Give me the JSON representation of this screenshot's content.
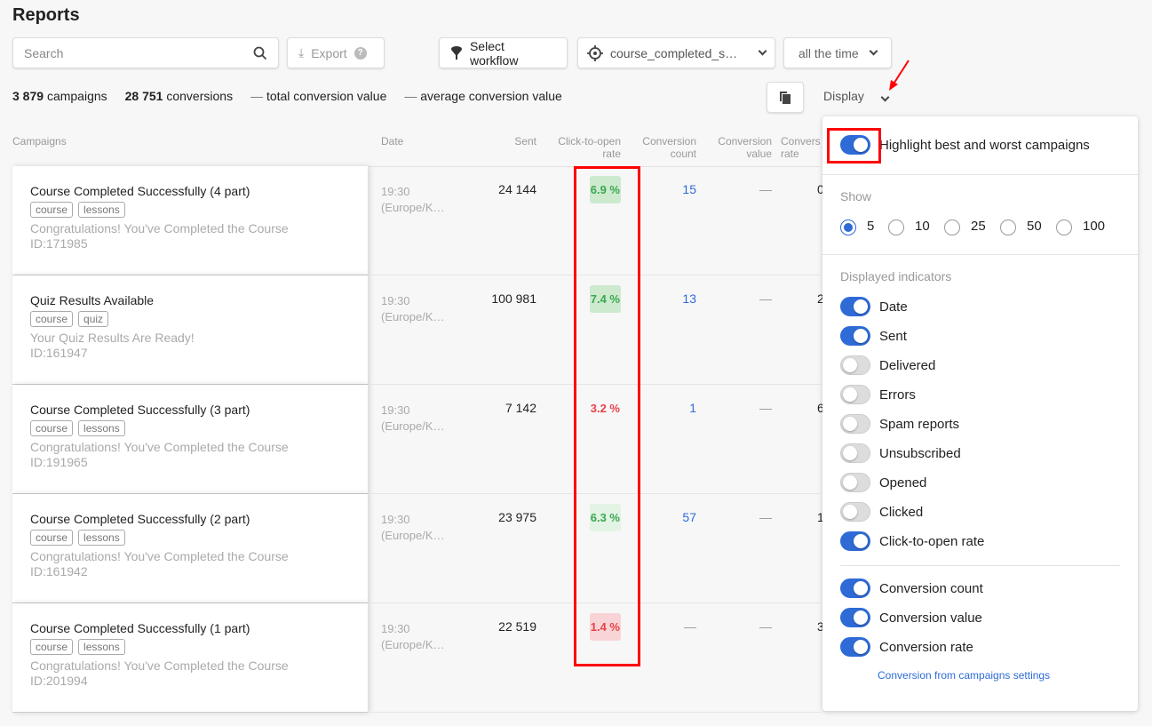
{
  "header": {
    "title": "Reports"
  },
  "toolbar": {
    "search_placeholder": "Search",
    "export_label": "Export",
    "workflow_label": "Select workflow",
    "segment_value": "course_completed_s…",
    "period_value": "all the time",
    "display_label": "Display"
  },
  "summary": {
    "campaigns_count": "3 879",
    "campaigns_label": "campaigns",
    "conversions_count": "28 751",
    "conversions_label": "conversions",
    "total_value": "—",
    "total_label": "total conversion value",
    "avg_value": "—",
    "avg_label": "average conversion value"
  },
  "columns": {
    "campaigns": "Campaigns",
    "date": "Date",
    "sent": "Sent",
    "ctor": "Click-to-open rate",
    "conv_count": "Conversion count",
    "conv_value": "Conversion value",
    "conv_rate": "Conversion rate"
  },
  "rows": [
    {
      "name": "Course Completed Successfully (4 part)",
      "tags": [
        "course",
        "lessons"
      ],
      "subject": "Congratulations! You've Completed the Course",
      "id": "ID:171985",
      "date": "19:30",
      "tz": "(Europe/K…",
      "sent": "24 144",
      "ctor": "6.9 %",
      "ctor_status": "best",
      "conv_count": "15",
      "conv_value": "—",
      "conv_rate": "0"
    },
    {
      "name": "Quiz Results Available",
      "tags": [
        "course",
        "quiz"
      ],
      "subject": "Your Quiz Results Are Ready!",
      "id": "ID:161947",
      "date": "19:30",
      "tz": "(Europe/K…",
      "sent": "100 981",
      "ctor": "7.4 %",
      "ctor_status": "best",
      "conv_count": "13",
      "conv_value": "—",
      "conv_rate": "2"
    },
    {
      "name": "Course Completed Successfully (3 part)",
      "tags": [
        "course",
        "lessons"
      ],
      "subject": "Congratulations! You've Completed the Course",
      "id": "ID:191965",
      "date": "19:30",
      "tz": "(Europe/K…",
      "sent": "7 142",
      "ctor": "3.2 %",
      "ctor_status": "worst",
      "conv_count": "1",
      "conv_value": "—",
      "conv_rate": "6"
    },
    {
      "name": "Course Completed Successfully (2 part)",
      "tags": [
        "course",
        "lessons"
      ],
      "subject": "Congratulations! You've Completed the Course",
      "id": "ID:161942",
      "date": "19:30",
      "tz": "(Europe/K…",
      "sent": "23 975",
      "ctor": "6.3 %",
      "ctor_status": "good",
      "conv_count": "57",
      "conv_value": "—",
      "conv_rate": "1"
    },
    {
      "name": "Course Completed Successfully (1 part)",
      "tags": [
        "course",
        "lessons"
      ],
      "subject": "Congratulations! You've Completed the Course",
      "id": "ID:201994",
      "date": "19:30",
      "tz": "(Europe/K…",
      "sent": "22 519",
      "ctor": "1.4 %",
      "ctor_status": "worst-strong",
      "conv_count": "—",
      "conv_value": "—",
      "conv_rate": "3"
    }
  ],
  "panel": {
    "highlight": {
      "label": "Highlight best and worst campaigns",
      "on": true
    },
    "show_label": "Show",
    "show_options": [
      "5",
      "10",
      "25",
      "50",
      "100"
    ],
    "show_selected": "5",
    "indicators_label": "Displayed indicators",
    "indicators": [
      {
        "label": "Date",
        "on": true
      },
      {
        "label": "Sent",
        "on": true
      },
      {
        "label": "Delivered",
        "on": false
      },
      {
        "label": "Errors",
        "on": false
      },
      {
        "label": "Spam reports",
        "on": false
      },
      {
        "label": "Unsubscribed",
        "on": false
      },
      {
        "label": "Opened",
        "on": false
      },
      {
        "label": "Clicked",
        "on": false
      },
      {
        "label": "Click-to-open rate",
        "on": true
      }
    ],
    "conversion_indicators": [
      {
        "label": "Conversion count",
        "on": true
      },
      {
        "label": "Conversion value",
        "on": true
      },
      {
        "label": "Conversion rate",
        "on": true
      }
    ],
    "settings_link": "Conversion from campaigns settings"
  },
  "colors": {
    "accent": "#2f6bd6",
    "best": "#3aa84f",
    "worst": "#e8414a",
    "annotation": "#ff0000"
  }
}
